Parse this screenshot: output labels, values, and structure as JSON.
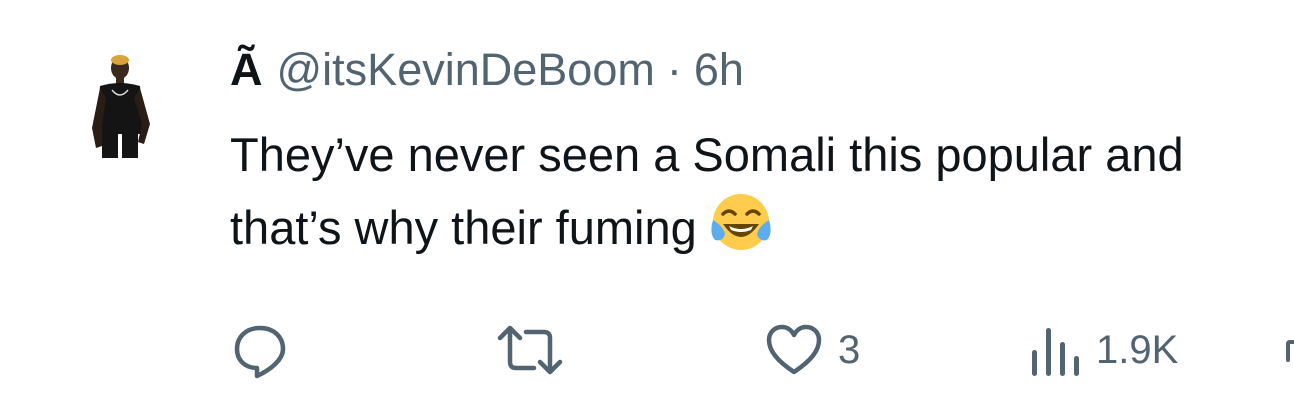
{
  "tweet": {
    "display_name": "Ã",
    "handle": "@itsKevinDeBoom",
    "separator": "·",
    "time": "6h",
    "text": "They’ve never seen a Somali this popular and that’s why their fuming",
    "emoji": "face-with-tears-of-joy-icon"
  },
  "actions": {
    "reply": {
      "icon": "reply-icon",
      "count": ""
    },
    "retweet": {
      "icon": "retweet-icon",
      "count": ""
    },
    "like": {
      "icon": "heart-icon",
      "count": "3"
    },
    "views": {
      "icon": "views-icon",
      "count": "1.9K"
    },
    "share": {
      "icon": "share-icon"
    }
  },
  "colors": {
    "text_primary": "#0f1419",
    "text_secondary": "#536471",
    "emoji_yellow": "#ffcc4d",
    "emoji_tears": "#5dadec"
  }
}
